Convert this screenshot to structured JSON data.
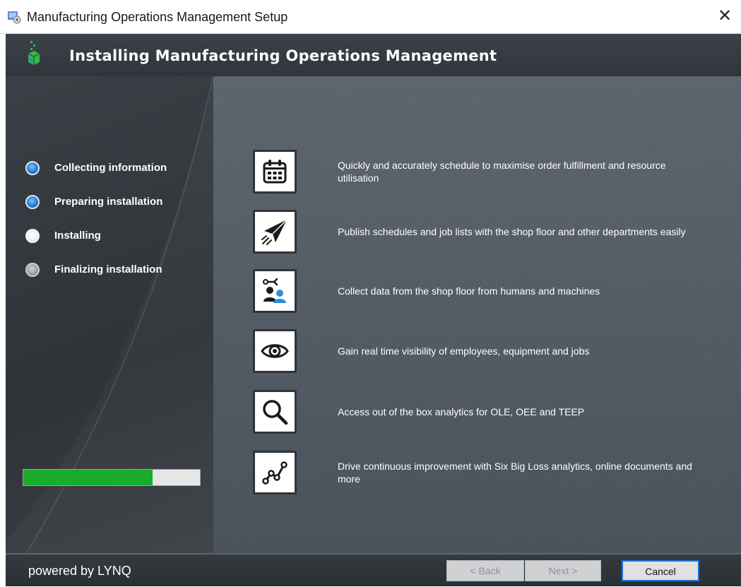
{
  "window": {
    "title": "Manufacturing Operations Management Setup",
    "close_glyph": "✕"
  },
  "header": {
    "heading": "Installing Manufacturing Operations Management",
    "logo_icon": "installer-logo-icon"
  },
  "steps": [
    {
      "label": "Collecting information",
      "state": "done"
    },
    {
      "label": "Preparing installation",
      "state": "done"
    },
    {
      "label": "Installing",
      "state": "current"
    },
    {
      "label": "Finalizing installation",
      "state": "pending"
    }
  ],
  "progress": {
    "fraction": 0.73,
    "fill_color": "#1aab2a"
  },
  "features": [
    {
      "icon": "calendar-icon",
      "text": "Quickly and accurately schedule to maximise order fulfillment and resource utilisation"
    },
    {
      "icon": "paper-plane-icon",
      "text": "Publish schedules and job lists with the shop floor and other departments easily"
    },
    {
      "icon": "robot-arm-worker-icon",
      "text": "Collect data from the shop floor from humans and machines"
    },
    {
      "icon": "eye-icon",
      "text": "Gain real time visibility of employees, equipment and jobs"
    },
    {
      "icon": "magnifier-icon",
      "text": "Access out of the box analytics for OLE, OEE and TEEP"
    },
    {
      "icon": "trend-line-icon",
      "text": "Drive continuous improvement with Six Big Loss analytics, online documents and more"
    }
  ],
  "footer": {
    "powered_by": "powered by LYNQ",
    "back_label": "< Back",
    "next_label": "Next >",
    "cancel_label": "Cancel"
  },
  "colors": {
    "accent_blue": "#1e6fd9",
    "header_bg": "#353a40"
  }
}
